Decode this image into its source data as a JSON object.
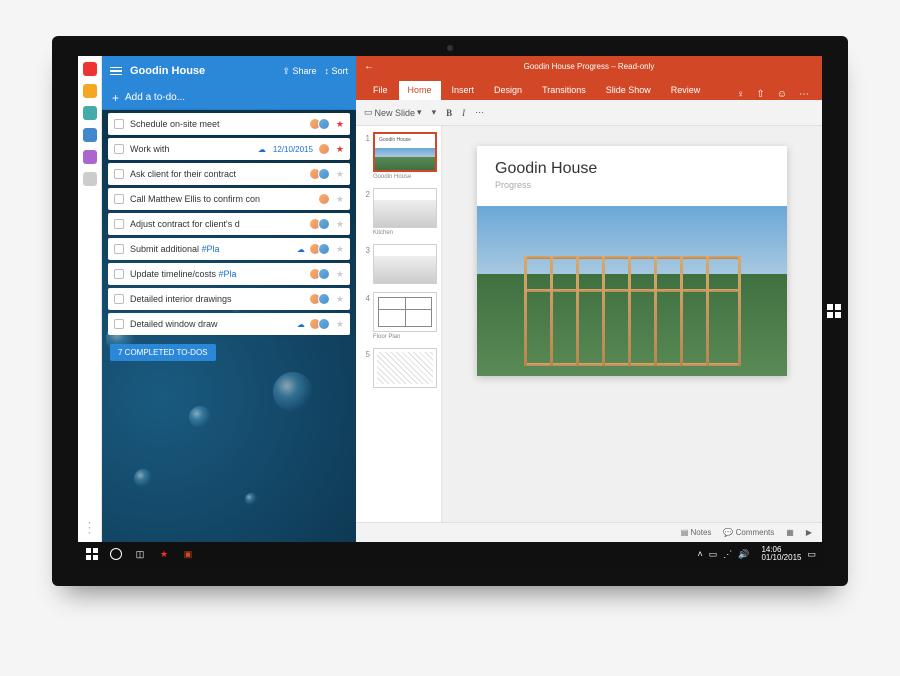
{
  "wunderlist": {
    "title": "Goodin House",
    "share_label": "Share",
    "sort_label": "Sort",
    "add_placeholder": "Add a to-do...",
    "completed_banner": "7 COMPLETED TO-DOS",
    "tasks": [
      {
        "label": "Schedule on-site meet",
        "date": "",
        "hash": "",
        "starred": true,
        "avatars": 2,
        "cloud": false
      },
      {
        "label": "Work with",
        "date": "12/10/2015",
        "hash": "",
        "starred": true,
        "avatars": 1,
        "cloud": true
      },
      {
        "label": "Ask client for their contract",
        "date": "",
        "hash": "",
        "starred": false,
        "avatars": 2,
        "cloud": false
      },
      {
        "label": "Call Matthew Ellis to confirm con",
        "date": "",
        "hash": "",
        "starred": false,
        "avatars": 1,
        "cloud": false
      },
      {
        "label": "Adjust contract for client's d",
        "date": "",
        "hash": "",
        "starred": false,
        "avatars": 2,
        "cloud": false
      },
      {
        "label": "Submit additional",
        "date": "",
        "hash": "#Pla",
        "starred": false,
        "avatars": 2,
        "cloud": true
      },
      {
        "label": "Update timeline/costs",
        "date": "",
        "hash": "#Pla",
        "starred": false,
        "avatars": 2,
        "cloud": false
      },
      {
        "label": "Detailed interior drawings",
        "date": "",
        "hash": "",
        "starred": false,
        "avatars": 2,
        "cloud": false
      },
      {
        "label": "Detailed window draw",
        "date": "",
        "hash": "",
        "starred": false,
        "avatars": 2,
        "cloud": true
      }
    ]
  },
  "powerpoint": {
    "window_title": "Goodin House Progress – Read-only",
    "tabs": [
      "File",
      "Home",
      "Insert",
      "Design",
      "Transitions",
      "Slide Show",
      "Review"
    ],
    "active_tab": "Home",
    "toolbar": {
      "new_slide": "New Slide"
    },
    "thumbnails": [
      {
        "n": "1",
        "caption": "Goodin House"
      },
      {
        "n": "2",
        "caption": "Kitchen"
      },
      {
        "n": "3",
        "caption": ""
      },
      {
        "n": "4",
        "caption": "Floor Plan"
      },
      {
        "n": "5",
        "caption": ""
      }
    ],
    "slide": {
      "title": "Goodin House",
      "subtitle": "Progress"
    },
    "status": {
      "notes": "Notes",
      "comments": "Comments"
    }
  },
  "taskbar": {
    "time": "14:06",
    "date": "01/10/2015"
  }
}
